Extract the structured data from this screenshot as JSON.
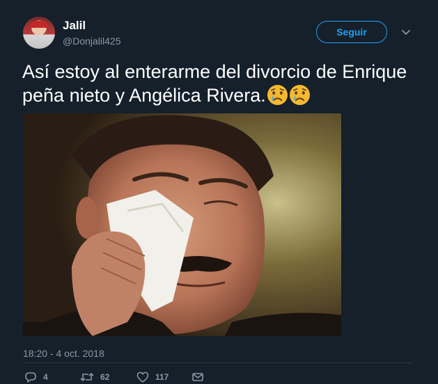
{
  "header": {
    "display_name": "Jalil",
    "handle": "@Donjalil425",
    "follow_label": "Seguir"
  },
  "tweet": {
    "text": "Así estoy al enterarme del divorcio de Enrique peña nieto y Angélica Rivera.",
    "emojis": [
      "crying-face",
      "crying-face"
    ],
    "timestamp": "18:20 - 4 oct. 2018"
  },
  "actions": {
    "replies": "4",
    "retweets": "62",
    "likes": "117"
  },
  "colors": {
    "background": "#15202b",
    "accent": "#1da1f2",
    "muted": "#8899a6"
  }
}
